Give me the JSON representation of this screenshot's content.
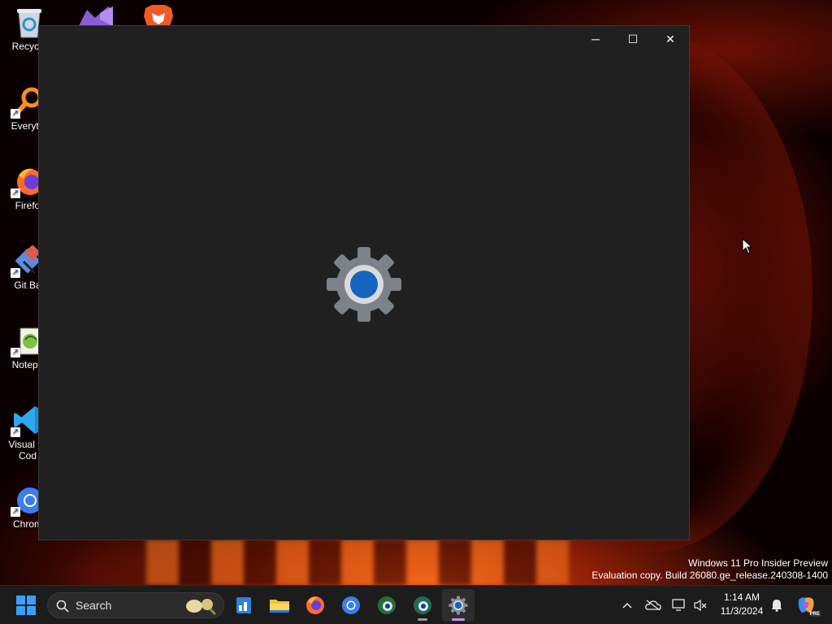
{
  "desktop": {
    "icons": [
      {
        "label": "Recycle",
        "icon": "recycle-bin-icon"
      },
      {
        "label": "Everyth",
        "icon": "everything-search-icon"
      },
      {
        "label": "Firefo",
        "icon": "firefox-icon"
      },
      {
        "label": "Git Ba",
        "icon": "git-bash-icon"
      },
      {
        "label": "Notepa",
        "icon": "notepad-plus-plus-icon"
      },
      {
        "label_line1": "Visual St",
        "label_line2": "Cod",
        "icon": "vscode-icon"
      },
      {
        "label": "Chrom",
        "icon": "chromium-icon"
      }
    ],
    "top_icons": [
      "visual-studio-icon",
      "brave-icon"
    ]
  },
  "window": {
    "caption": {
      "minimize": "─",
      "maximize": "☐",
      "close": "✕"
    },
    "splash_icon": "settings-gear-icon",
    "colors": {
      "background": "#202020",
      "gear_outer": "#7d8188",
      "gear_core": "#1565c0"
    }
  },
  "watermark": {
    "line1": "Windows 11 Pro Insider Preview",
    "line2": "Evaluation copy. Build 26080.ge_release.240308-1400"
  },
  "taskbar": {
    "start_icon": "windows-start-icon",
    "search": {
      "placeholder": "Search",
      "icon": "search-icon"
    },
    "apps": [
      {
        "name": "widgets",
        "icon": "widgets-icon"
      },
      {
        "name": "file-explorer",
        "icon": "folder-icon"
      },
      {
        "name": "firefox",
        "icon": "firefox-icon"
      },
      {
        "name": "chromium",
        "icon": "chromium-icon"
      },
      {
        "name": "edge-canary",
        "icon": "edge-icon"
      },
      {
        "name": "edge-dev",
        "icon": "edge-dev-icon",
        "running": true
      },
      {
        "name": "settings",
        "icon": "settings-gear-icon",
        "active": true
      }
    ],
    "tray": {
      "icons": [
        "chevron-up-icon",
        "onedrive-offline-icon",
        "network-icon",
        "volume-muted-icon"
      ],
      "time": "1:14 AM",
      "date": "11/3/2024",
      "notification_icon": "bell-icon",
      "copilot_badge": "PRE"
    }
  }
}
